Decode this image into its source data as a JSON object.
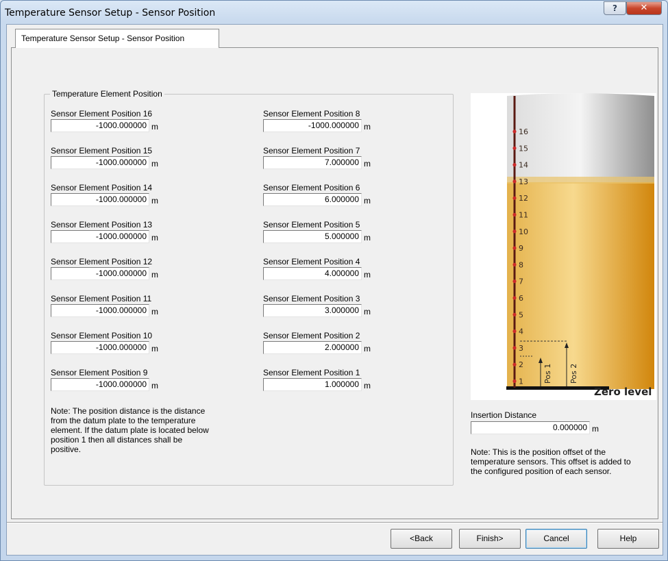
{
  "window": {
    "title": "Temperature Sensor Setup - Sensor Position",
    "help_glyph": "?",
    "close_glyph": "✕"
  },
  "tab": {
    "label": "Temperature Sensor Setup - Sensor Position"
  },
  "group": {
    "label": "Temperature Element Position"
  },
  "unit": "m",
  "left_column": [
    {
      "label": "Sensor Element Position 16",
      "value": "-1000.000000"
    },
    {
      "label": "Sensor Element Position 15",
      "value": "-1000.000000"
    },
    {
      "label": "Sensor Element Position 14",
      "value": "-1000.000000"
    },
    {
      "label": "Sensor Element Position 13",
      "value": "-1000.000000"
    },
    {
      "label": "Sensor Element Position 12",
      "value": "-1000.000000"
    },
    {
      "label": "Sensor Element Position 11",
      "value": "-1000.000000"
    },
    {
      "label": "Sensor Element Position 10",
      "value": "-1000.000000"
    },
    {
      "label": "Sensor Element Position 9",
      "value": "-1000.000000"
    }
  ],
  "right_column": [
    {
      "label": "Sensor Element Position 8",
      "value": "-1000.000000"
    },
    {
      "label": "Sensor Element Position 7",
      "value": "7.000000"
    },
    {
      "label": "Sensor Element Position 6",
      "value": "6.000000"
    },
    {
      "label": "Sensor Element Position 5",
      "value": "5.000000"
    },
    {
      "label": "Sensor Element Position 4",
      "value": "4.000000"
    },
    {
      "label": "Sensor Element Position 3",
      "value": "3.000000"
    },
    {
      "label": "Sensor Element Position 2",
      "value": "2.000000"
    },
    {
      "label": "Sensor Element Position 1",
      "value": "1.000000"
    }
  ],
  "note_left": [
    "Note: The position distance is the distance",
    "from the datum plate to the temperature",
    "element. If the datum plate is located below",
    "position 1 then all distances shall be",
    "positive."
  ],
  "diagram": {
    "tick_labels": [
      "16",
      "15",
      "14",
      "13",
      "12",
      "11",
      "10",
      "9",
      "8",
      "7",
      "6",
      "5",
      "4",
      "3",
      "2",
      "1"
    ],
    "pos1_label": "Pos 1",
    "pos2_label": "Pos 2",
    "zero_label": "Zero level",
    "colors": {
      "liquid_light": "#f6d88a",
      "liquid_dark": "#d88f10",
      "gas_light": "#f2f2f2",
      "gas_dark": "#9a9a9a",
      "rod": "#5a1a12",
      "dot": "#cc2a2a"
    }
  },
  "insertion": {
    "label": "Insertion Distance",
    "value": "0.000000"
  },
  "note_right": [
    "Note: This is the position offset of the",
    "temperature sensors. This offset is added to",
    "the configured position of each sensor."
  ],
  "buttons": {
    "back": "<Back",
    "finish": "Finish>",
    "cancel": "Cancel",
    "help": "Help"
  }
}
